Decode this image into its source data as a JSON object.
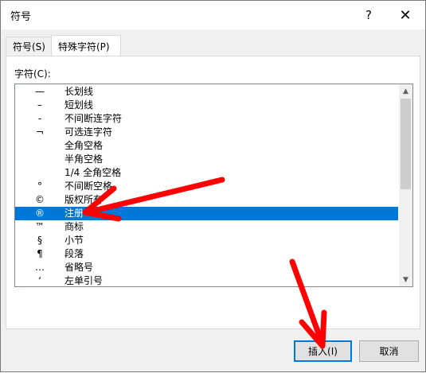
{
  "window": {
    "title": "符号",
    "help_glyph": "?",
    "close_glyph": "✕"
  },
  "tabs": [
    {
      "label": "符号(S)",
      "active": false
    },
    {
      "label": "特殊字符(P)",
      "active": true
    }
  ],
  "list": {
    "label": "字符(C):",
    "selected_index": 9,
    "items": [
      {
        "symbol": "—",
        "name": "长划线"
      },
      {
        "symbol": "–",
        "name": "短划线"
      },
      {
        "symbol": "-",
        "name": "不间断连字符"
      },
      {
        "symbol": "¬",
        "name": "可选连字符"
      },
      {
        "symbol": "",
        "name": "全角空格"
      },
      {
        "symbol": "",
        "name": "半角空格"
      },
      {
        "symbol": "",
        "name": "1/4 全角空格"
      },
      {
        "symbol": "°",
        "name": "不间断空格"
      },
      {
        "symbol": "©",
        "name": "版权所有"
      },
      {
        "symbol": "®",
        "name": "注册"
      },
      {
        "symbol": "™",
        "name": "商标"
      },
      {
        "symbol": "§",
        "name": "小节"
      },
      {
        "symbol": "¶",
        "name": "段落"
      },
      {
        "symbol": "…",
        "name": "省略号"
      },
      {
        "symbol": "‘",
        "name": "左单引号"
      }
    ]
  },
  "buttons": {
    "insert": "插入(I)",
    "cancel": "取消"
  },
  "annotation": {
    "arrow_color": "#ff0000"
  },
  "colors": {
    "selection": "#0078d7",
    "focus_border": "#0078d7"
  }
}
